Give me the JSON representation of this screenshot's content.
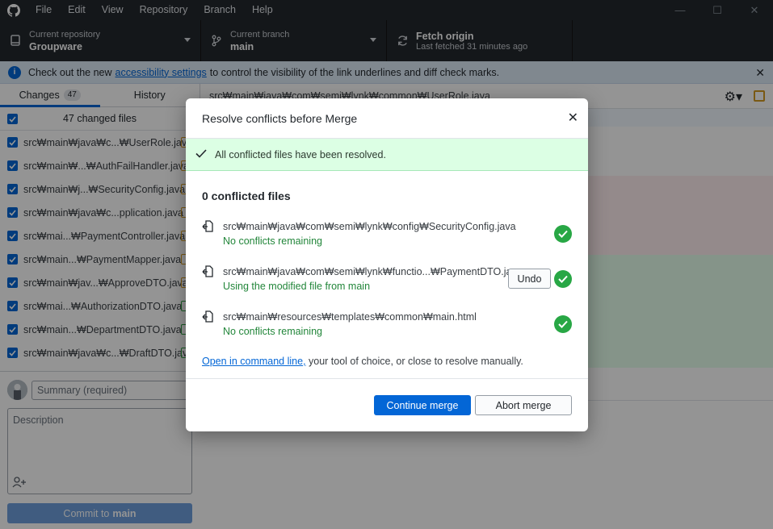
{
  "menu": [
    "File",
    "Edit",
    "View",
    "Repository",
    "Branch",
    "Help"
  ],
  "toolbar": {
    "repo_label": "Current repository",
    "repo_value": "Groupware",
    "branch_label": "Current branch",
    "branch_value": "main",
    "fetch_label": "Fetch origin",
    "fetch_sub": "Last fetched 31 minutes ago"
  },
  "banner": {
    "prefix": "Check out the new",
    "link": "accessibility settings",
    "suffix": "to control the visibility of the link underlines and diff check marks."
  },
  "sidebar": {
    "tab_changes": "Changes",
    "tab_changes_count": "47",
    "tab_history": "History",
    "changed_files": "47 changed files",
    "files": [
      {
        "name": "src₩main₩java₩c...₩UserRole.java",
        "status": "modified"
      },
      {
        "name": "src₩main₩...₩AuthFailHandler.java",
        "status": "modified"
      },
      {
        "name": "src₩main₩j...₩SecurityConfig.java",
        "status": "modified"
      },
      {
        "name": "src₩main₩java₩c...pplication.java",
        "status": "modified"
      },
      {
        "name": "src₩mai...₩PaymentController.java",
        "status": "modified"
      },
      {
        "name": "src₩main...₩PaymentMapper.java",
        "status": "modified"
      },
      {
        "name": "src₩main₩jav...₩ApproveDTO.java",
        "status": "modified"
      },
      {
        "name": "src₩mai...₩AuthorizationDTO.java",
        "status": "added"
      },
      {
        "name": "src₩main...₩DepartmentDTO.java",
        "status": "added"
      },
      {
        "name": "src₩main₩java₩c...₩DraftDTO.java",
        "status": "added"
      }
    ],
    "summary_placeholder": "Summary (required)",
    "description_placeholder": "Description",
    "commit_prefix": "Commit to",
    "commit_branch": "main"
  },
  "diff": {
    "path": "src₩main₩java₩com₩semi₩lynk₩common₩UserRole.java"
  },
  "dialog": {
    "title": "Resolve conflicts before Merge",
    "success": "All conflicted files have been resolved.",
    "count_title": "0 conflicted files",
    "files": [
      {
        "path": "src₩main₩java₩com₩semi₩lynk₩config₩SecurityConfig.java",
        "status": "No conflicts remaining"
      },
      {
        "path": "src₩main₩java₩com₩semi₩lynk₩functio...₩PaymentDTO.java",
        "status": "Using the modified file from main",
        "undo": "Undo"
      },
      {
        "path": "src₩main₩resources₩templates₩common₩main.html",
        "status": "No conflicts remaining"
      }
    ],
    "cmd_link": "Open in command line,",
    "cmd_rest": " your tool of choice, or close to resolve manually.",
    "continue": "Continue merge",
    "abort": "Abort merge"
  },
  "colors": {
    "accent": "#0366d6",
    "success_bg": "#dcffe4",
    "success_green": "#28a745",
    "toolbar_bg": "#24292e"
  }
}
